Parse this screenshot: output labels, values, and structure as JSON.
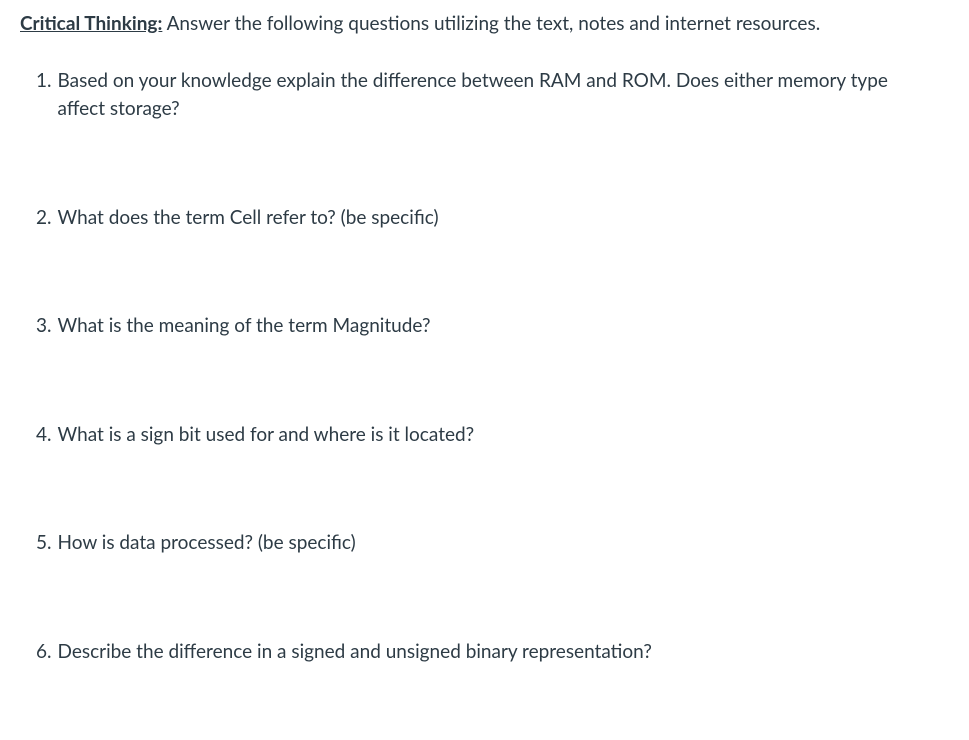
{
  "intro": {
    "title": "Critical Thinking:",
    "instruction": " Answer the following questions utilizing the text, notes and internet resources."
  },
  "questions": [
    {
      "number": "1.",
      "text": "Based on your knowledge explain the difference between RAM and ROM. Does either memory type affect storage?"
    },
    {
      "number": "2.",
      "text": "What does the term Cell refer to? (be specific)"
    },
    {
      "number": "3.",
      "text": "What is the meaning of the term Magnitude?"
    },
    {
      "number": "4.",
      "text": "What is a sign bit used for and where is it located?"
    },
    {
      "number": "5.",
      "text": "How is data processed? (be specific)"
    },
    {
      "number": "6.",
      "text": "Describe the difference in a signed and unsigned binary representation?"
    }
  ]
}
